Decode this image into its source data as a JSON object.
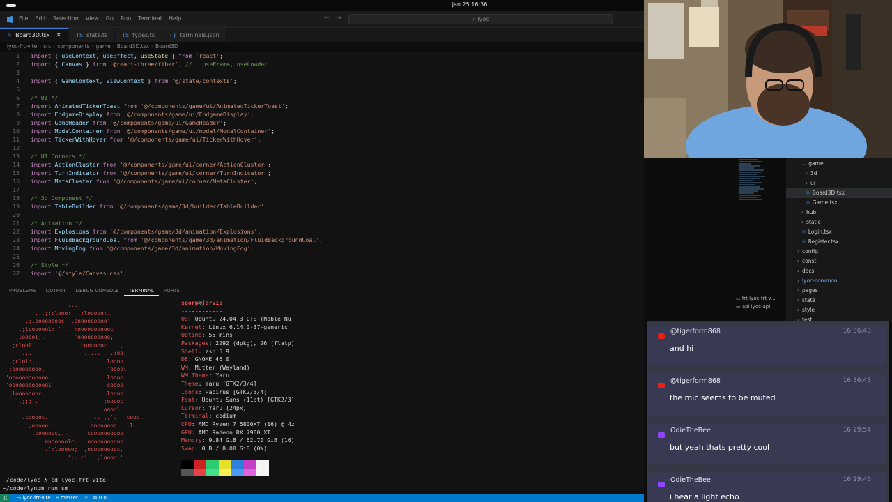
{
  "topbar": {
    "clock": "Jan 25  16:36"
  },
  "menu": [
    "File",
    "Edit",
    "Selection",
    "View",
    "Go",
    "Run",
    "Terminal",
    "Help"
  ],
  "command_center": "lyoc",
  "tabs": [
    {
      "label": "Board3D.tsx",
      "active": true
    },
    {
      "label": "state.ts",
      "active": false
    },
    {
      "label": "types.ts",
      "active": false
    },
    {
      "label": "terminals.json",
      "active": false
    }
  ],
  "breadcrumb": [
    "lyoc-frt-vite",
    "src",
    "components",
    "game",
    "Board3D.tsx",
    "Board3D"
  ],
  "code_lines": [
    {
      "n": "1",
      "t": [
        [
          "kw",
          "import"
        ],
        [
          "pl",
          " { "
        ],
        [
          "id",
          "useContext"
        ],
        [
          "pl",
          ", "
        ],
        [
          "id",
          "useEffect"
        ],
        [
          "pl",
          ", "
        ],
        [
          "fn",
          "useState"
        ],
        [
          "pl",
          " } "
        ],
        [
          "kw",
          "from"
        ],
        [
          "pl",
          " "
        ],
        [
          "str",
          "'react'"
        ],
        [
          "pl",
          ";"
        ]
      ]
    },
    {
      "n": "2",
      "t": [
        [
          "kw",
          "import"
        ],
        [
          "pl",
          " { "
        ],
        [
          "id",
          "Canvas"
        ],
        [
          "pl",
          " } "
        ],
        [
          "kw",
          "from"
        ],
        [
          "pl",
          " "
        ],
        [
          "str",
          "'@react-three/fiber'"
        ],
        [
          "pl",
          "; "
        ],
        [
          "cm",
          "// , useFrame, useLoader"
        ]
      ]
    },
    {
      "n": "3",
      "t": []
    },
    {
      "n": "4",
      "t": [
        [
          "kw",
          "import"
        ],
        [
          "pl",
          " { "
        ],
        [
          "id",
          "GameContext"
        ],
        [
          "pl",
          ", "
        ],
        [
          "id",
          "ViewContext"
        ],
        [
          "pl",
          " } "
        ],
        [
          "kw",
          "from"
        ],
        [
          "pl",
          " "
        ],
        [
          "str",
          "'@/state/contexts'"
        ],
        [
          "pl",
          ";"
        ]
      ]
    },
    {
      "n": "5",
      "t": []
    },
    {
      "n": "6",
      "t": [
        [
          "cm",
          "/* UI */"
        ]
      ]
    },
    {
      "n": "7",
      "t": [
        [
          "kw",
          "import"
        ],
        [
          "pl",
          " "
        ],
        [
          "id",
          "AnimatedTickerToast"
        ],
        [
          "pl",
          " "
        ],
        [
          "kw",
          "from"
        ],
        [
          "pl",
          " "
        ],
        [
          "str",
          "'@/components/game/ui/AnimatedTickerToast'"
        ],
        [
          "pl",
          ";"
        ]
      ]
    },
    {
      "n": "8",
      "t": [
        [
          "kw",
          "import"
        ],
        [
          "pl",
          " "
        ],
        [
          "id",
          "EndgameDisplay"
        ],
        [
          "pl",
          " "
        ],
        [
          "kw",
          "from"
        ],
        [
          "pl",
          " "
        ],
        [
          "str",
          "'@/components/game/ui/EndgameDisplay'"
        ],
        [
          "pl",
          ";"
        ]
      ]
    },
    {
      "n": "9",
      "t": [
        [
          "kw",
          "import"
        ],
        [
          "pl",
          " "
        ],
        [
          "id",
          "GameHeader"
        ],
        [
          "pl",
          " "
        ],
        [
          "kw",
          "from"
        ],
        [
          "pl",
          " "
        ],
        [
          "str",
          "'@/components/game/ui/GameHeader'"
        ],
        [
          "pl",
          ";"
        ]
      ]
    },
    {
      "n": "10",
      "t": [
        [
          "kw",
          "import"
        ],
        [
          "pl",
          " "
        ],
        [
          "id",
          "ModalContainer"
        ],
        [
          "pl",
          " "
        ],
        [
          "kw",
          "from"
        ],
        [
          "pl",
          " "
        ],
        [
          "str",
          "'@/components/game/ui/modal/ModalContainer'"
        ],
        [
          "pl",
          ";"
        ]
      ]
    },
    {
      "n": "11",
      "t": [
        [
          "kw",
          "import"
        ],
        [
          "pl",
          " "
        ],
        [
          "id",
          "TickerWithHover"
        ],
        [
          "pl",
          " "
        ],
        [
          "kw",
          "from"
        ],
        [
          "pl",
          " "
        ],
        [
          "str",
          "'@/components/game/ui/TickerWithHover'"
        ],
        [
          "pl",
          ";"
        ]
      ]
    },
    {
      "n": "12",
      "t": []
    },
    {
      "n": "13",
      "t": [
        [
          "cm",
          "/* UI Corners */"
        ]
      ]
    },
    {
      "n": "14",
      "t": [
        [
          "kw",
          "import"
        ],
        [
          "pl",
          " "
        ],
        [
          "id",
          "ActionCluster"
        ],
        [
          "pl",
          " "
        ],
        [
          "kw",
          "from"
        ],
        [
          "pl",
          " "
        ],
        [
          "str",
          "'@/components/game/ui/corner/ActionCluster'"
        ],
        [
          "pl",
          ";"
        ]
      ]
    },
    {
      "n": "15",
      "t": [
        [
          "kw",
          "import"
        ],
        [
          "pl",
          " "
        ],
        [
          "id",
          "TurnIndicator"
        ],
        [
          "pl",
          " "
        ],
        [
          "kw",
          "from"
        ],
        [
          "pl",
          " "
        ],
        [
          "str",
          "'@/components/game/ui/corner/TurnIndicator'"
        ],
        [
          "pl",
          ";"
        ]
      ]
    },
    {
      "n": "16",
      "t": [
        [
          "kw",
          "import"
        ],
        [
          "pl",
          " "
        ],
        [
          "id",
          "MetaCluster"
        ],
        [
          "pl",
          " "
        ],
        [
          "kw",
          "from"
        ],
        [
          "pl",
          " "
        ],
        [
          "str",
          "'@/components/game/ui/corner/MetaCluster'"
        ],
        [
          "pl",
          ";"
        ]
      ]
    },
    {
      "n": "17",
      "t": []
    },
    {
      "n": "18",
      "t": [
        [
          "cm",
          "/* 3d Component */"
        ]
      ]
    },
    {
      "n": "19",
      "t": [
        [
          "kw",
          "import"
        ],
        [
          "pl",
          " "
        ],
        [
          "id",
          "TableBuilder"
        ],
        [
          "pl",
          " "
        ],
        [
          "kw",
          "from"
        ],
        [
          "pl",
          " "
        ],
        [
          "str",
          "'@/components/game/3d/builder/TableBuilder'"
        ],
        [
          "pl",
          ";"
        ]
      ]
    },
    {
      "n": "20",
      "t": []
    },
    {
      "n": "21",
      "t": [
        [
          "cm",
          "/* Animation */"
        ]
      ]
    },
    {
      "n": "22",
      "t": [
        [
          "kw",
          "import"
        ],
        [
          "pl",
          " "
        ],
        [
          "id",
          "Explosions"
        ],
        [
          "pl",
          " "
        ],
        [
          "kw",
          "from"
        ],
        [
          "pl",
          " "
        ],
        [
          "str",
          "'@/components/game/3d/animation/Explosions'"
        ],
        [
          "pl",
          ";"
        ]
      ]
    },
    {
      "n": "23",
      "t": [
        [
          "kw",
          "import"
        ],
        [
          "pl",
          " "
        ],
        [
          "id",
          "FluidBackgroundCoal"
        ],
        [
          "pl",
          " "
        ],
        [
          "kw",
          "from"
        ],
        [
          "pl",
          " "
        ],
        [
          "str",
          "'@/components/game/3d/animation/FluidBackgroundCoal'"
        ],
        [
          "pl",
          ";"
        ]
      ]
    },
    {
      "n": "24",
      "t": [
        [
          "kw",
          "import"
        ],
        [
          "pl",
          " "
        ],
        [
          "id",
          "MovingFog"
        ],
        [
          "pl",
          " "
        ],
        [
          "kw",
          "from"
        ],
        [
          "pl",
          " "
        ],
        [
          "str",
          "'@/components/game/3d/animation/MovingFog'"
        ],
        [
          "pl",
          ";"
        ]
      ]
    },
    {
      "n": "25",
      "t": []
    },
    {
      "n": "26",
      "t": [
        [
          "cm",
          "/* Style */"
        ]
      ]
    },
    {
      "n": "27",
      "t": [
        [
          "kw",
          "import"
        ],
        [
          "pl",
          " "
        ],
        [
          "str",
          "'@/style/Canvas.css'"
        ],
        [
          "pl",
          ";"
        ]
      ]
    }
  ],
  "panel_tabs": [
    "PROBLEMS",
    "OUTPUT",
    "DEBUG CONSOLE",
    "TERMINAL",
    "PORTS"
  ],
  "terminal_list": [
    "frt lyoc-frt-v...",
    "api lyoc-api"
  ],
  "ascii_art": "                   ....              \n         .',;:clooo:  .:looooo:.     \n      .;looooooooc  .oooooooooo'     \n    .;looooool:,''.  :ooooooooooc     \n   ;looool;.         'oooooooooo,     \n  ;clool'             .cooooooc.  ,,  \n     ...                ......  .:oo, \n .;clol:,.                    .loooo' \n :ooooooooo,                   'ooool \n'oooooooooooo.                 loooo. \n'ooooooooooool                 coooo. \n ,loooooooc.                  .loooo. \n   .,;;;'.                    ;ooooc  \n        ...                  ,ooool.  \n     .cooooc.              ..',,'.  .cooo. \n       ;ooooo:.          ;oooooooc.  :l. \n        .coooooc,..      coooooooooo.    \n          .:ooooooolc:. .ooooooooooo'    \n            .':looooo;  ,oooooooooc.     \n                 ..';::c'  .;loooo:'     ",
  "fetch": {
    "user": "sporp",
    "host": "jarvis",
    "separator": "------------",
    "rows": [
      [
        "OS",
        "Ubuntu 24.04.3 LTS (Noble Nu"
      ],
      [
        "Kernel",
        "Linux 6.14.0-37-generic"
      ],
      [
        "Uptime",
        "55 mins"
      ],
      [
        "Packages",
        "2292 (dpkg), 26 (flatp)"
      ],
      [
        "Shell",
        "zsh 5.9"
      ],
      [
        "DE",
        "GNOME 46.0"
      ],
      [
        "WM",
        "Mutter (Wayland)"
      ],
      [
        "WM Theme",
        "Yaru"
      ],
      [
        "Theme",
        "Yaru [GTK2/3/4]"
      ],
      [
        "Icons",
        "Papirus [GTK2/3/4]"
      ],
      [
        "Font",
        "Ubuntu Sans (11pt) [GTK2/3]"
      ],
      [
        "Cursor",
        "Yaru (24px)"
      ],
      [
        "Terminal",
        "codium"
      ],
      [
        "CPU",
        "AMD Ryzen 7 5800XT (16) @ 4z"
      ],
      [
        "GPU",
        "AMD Radeon RX 7900 XT"
      ],
      [
        "Memory",
        "9.84 GiB / 62.70 GiB (16)"
      ],
      [
        "Swap",
        "0 B / 8.00 GiB (0%)"
      ]
    ],
    "palette_top": [
      "#000000",
      "#cc2222",
      "#2ecc71",
      "#e6e02a",
      "#2f7fdc",
      "#c23fc6",
      "#2ec4c4"
    ],
    "palette_bottom": [
      "#555555",
      "#e04444",
      "#44dd88",
      "#f5f055",
      "#4a9af0",
      "#dd66dd",
      "#55dddd"
    ],
    "palette_white": "#f4f4f4"
  },
  "prompt_lines": [
    "~/code/lyoc λ cd lyoc-frt-vite",
    "~/code/lynpm run sm"
  ],
  "statusbar": {
    "remote": "lyoc-frt-vite",
    "branch": "master",
    "problems": "0  0"
  },
  "explorer": [
    {
      "label": "game",
      "kind": "folder-open",
      "indent": 0
    },
    {
      "label": "3d",
      "kind": "folder",
      "indent": 1
    },
    {
      "label": "ui",
      "kind": "folder",
      "indent": 1
    },
    {
      "label": "Board3D.tsx",
      "kind": "file",
      "indent": 1,
      "selected": true
    },
    {
      "label": "Game.tsx",
      "kind": "file",
      "indent": 1
    },
    {
      "label": "hub",
      "kind": "folder",
      "indent": 0
    },
    {
      "label": "static",
      "kind": "folder",
      "indent": 0
    },
    {
      "label": "Login.tsx",
      "kind": "file",
      "indent": 0
    },
    {
      "label": "Register.tsx",
      "kind": "file",
      "indent": 0
    },
    {
      "label": "config",
      "kind": "folder",
      "indent": -1
    },
    {
      "label": "const",
      "kind": "folder",
      "indent": -1
    },
    {
      "label": "docs",
      "kind": "folder",
      "indent": -1
    },
    {
      "label": "lyoc-common",
      "kind": "folder-alt",
      "indent": -1
    },
    {
      "label": "pages",
      "kind": "folder",
      "indent": -1
    },
    {
      "label": "state",
      "kind": "folder",
      "indent": -1
    },
    {
      "label": "style",
      "kind": "folder",
      "indent": -1
    },
    {
      "label": "test",
      "kind": "folder",
      "indent": -1
    }
  ],
  "chat": [
    {
      "platform": "youtube",
      "name": "@tigerform868",
      "time": "16:36:43",
      "message": "and hi"
    },
    {
      "platform": "youtube",
      "name": "@tigerform868",
      "time": "16:36:43",
      "message": "the mic seems to be muted"
    },
    {
      "platform": "twitch",
      "name": "OdieTheBee",
      "time": "16:29:54",
      "message": "but yeah thats pretty cool"
    },
    {
      "platform": "twitch",
      "name": "OdieTheBee",
      "time": "16:29:46",
      "message": "i hear a light echo"
    }
  ],
  "colors": {
    "youtube": "#e62117",
    "twitch": "#9147ff",
    "accent": "#007acc"
  }
}
